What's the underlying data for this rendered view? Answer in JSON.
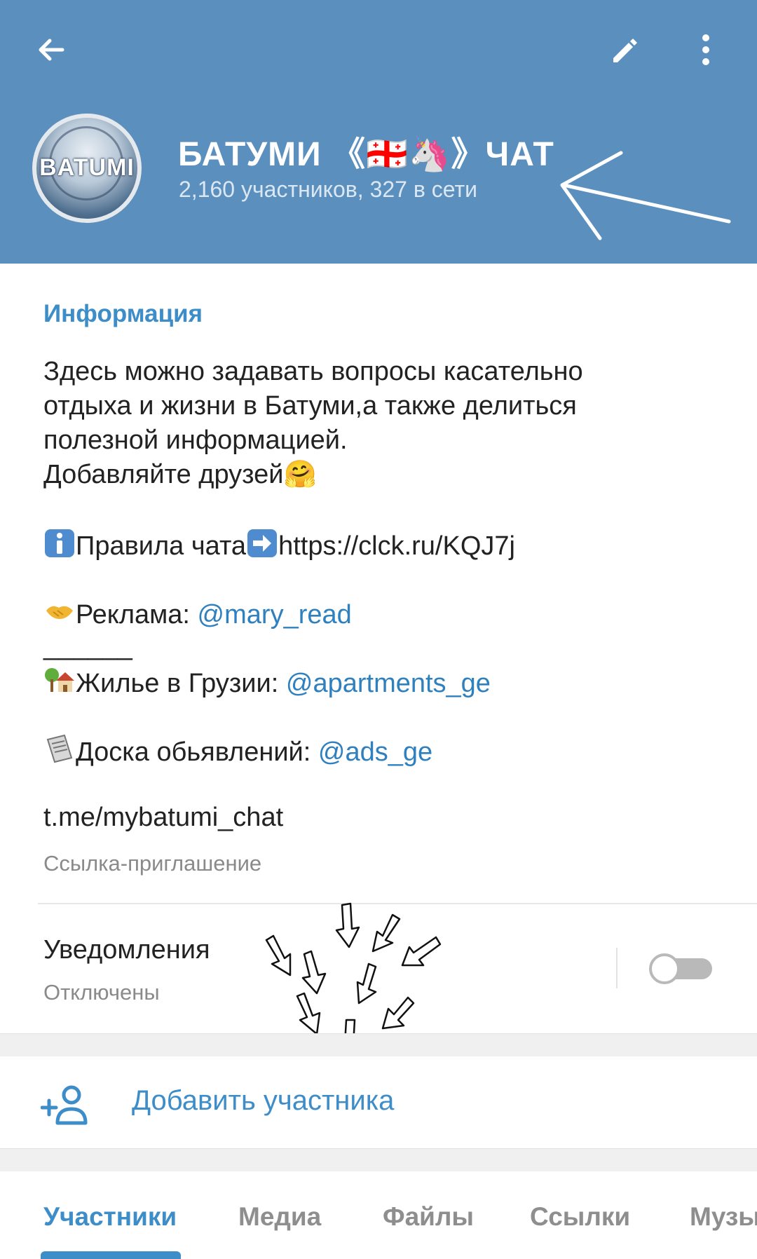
{
  "header": {
    "title": "БАТУМИ 《🇬🇪🦄》ЧАТ",
    "subtitle": "2,160 участников, 327 в сети",
    "avatar_text": "BATUMI",
    "back_icon": "arrow-left-icon",
    "edit_icon": "pencil-icon",
    "menu_icon": "more-vertical-icon",
    "background_color": "#5b8fbe"
  },
  "info": {
    "section_title": "Информация",
    "description": {
      "line1": "Здесь можно задавать вопросы касательно",
      "line2": "отдыха и жизни в Батуми,а также делиться",
      "line3": "полезной информацией.",
      "line4": "Добавляйте друзей🤗",
      "rules_label": "Правила чата",
      "rules_url": "https://clck.ru/KQJ7j",
      "ads_label": "Реклама: ",
      "ads_handle": "@mary_read",
      "separator": "______",
      "housing_label": "Жилье в Грузии: ",
      "housing_handle": "@apartments_ge",
      "board_label": "Доска обьявлений: ",
      "board_handle": "@ads_ge"
    },
    "invite_link": "t.me/mybatumi_chat",
    "invite_caption": "Ссылка-приглашение"
  },
  "notifications": {
    "label": "Уведомления",
    "status": "Отключены",
    "enabled": false
  },
  "add_member": {
    "label": "Добавить участника",
    "icon": "add-user-icon"
  },
  "tabs": {
    "items": [
      "Участники",
      "Медиа",
      "Файлы",
      "Ссылки",
      "Музыка"
    ],
    "active": "Участники"
  },
  "colors": {
    "accent": "#3d8dc9",
    "link": "#2f80bf"
  }
}
